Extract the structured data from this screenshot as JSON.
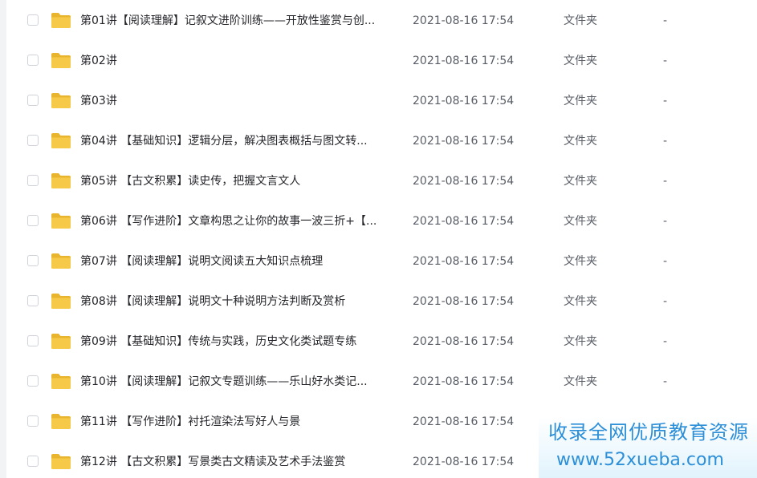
{
  "icons": {
    "checkbox": "checkbox-unchecked-icon",
    "folder": "folder-icon"
  },
  "colors": {
    "folder": "#f7c948",
    "folder_tab": "#eab52e",
    "watermark_text": "#2d8fd8"
  },
  "files": [
    {
      "name": "第01讲【阅读理解】记叙文进阶训练——开放性鉴赏与创...",
      "modified": "2021-08-16 17:54",
      "type": "文件夹",
      "size": "-"
    },
    {
      "name": "第02讲",
      "modified": "2021-08-16 17:54",
      "type": "文件夹",
      "size": "-"
    },
    {
      "name": "第03讲",
      "modified": "2021-08-16 17:54",
      "type": "文件夹",
      "size": "-"
    },
    {
      "name": "第04讲 【基础知识】逻辑分层，解决图表概括与图文转...",
      "modified": "2021-08-16 17:54",
      "type": "文件夹",
      "size": "-"
    },
    {
      "name": "第05讲 【古文积累】读史传，把握文言文人",
      "modified": "2021-08-16 17:54",
      "type": "文件夹",
      "size": "-"
    },
    {
      "name": "第06讲 【写作进阶】文章构思之让你的故事一波三折+【...",
      "modified": "2021-08-16 17:54",
      "type": "文件夹",
      "size": "-"
    },
    {
      "name": "第07讲 【阅读理解】说明文阅读五大知识点梳理",
      "modified": "2021-08-16 17:54",
      "type": "文件夹",
      "size": "-"
    },
    {
      "name": "第08讲 【阅读理解】说明文十种说明方法判断及赏析",
      "modified": "2021-08-16 17:54",
      "type": "文件夹",
      "size": "-"
    },
    {
      "name": "第09讲 【基础知识】传统与实践，历史文化类试题专练",
      "modified": "2021-08-16 17:54",
      "type": "文件夹",
      "size": "-"
    },
    {
      "name": "第10讲 【阅读理解】记叙文专题训练——乐山好水类记...",
      "modified": "2021-08-16 17:54",
      "type": "文件夹",
      "size": "-"
    },
    {
      "name": "第11讲 【写作进阶】衬托渲染法写好人与景",
      "modified": "2021-08-16 17:54",
      "type": "",
      "size": ""
    },
    {
      "name": "第12讲 【古文积累】写景类古文精读及艺术手法鉴赏",
      "modified": "2021-08-16 17:54",
      "type": "",
      "size": ""
    }
  ],
  "watermark": {
    "line1": "收录全网优质教育资源",
    "line2": "www.52xueba.com"
  }
}
